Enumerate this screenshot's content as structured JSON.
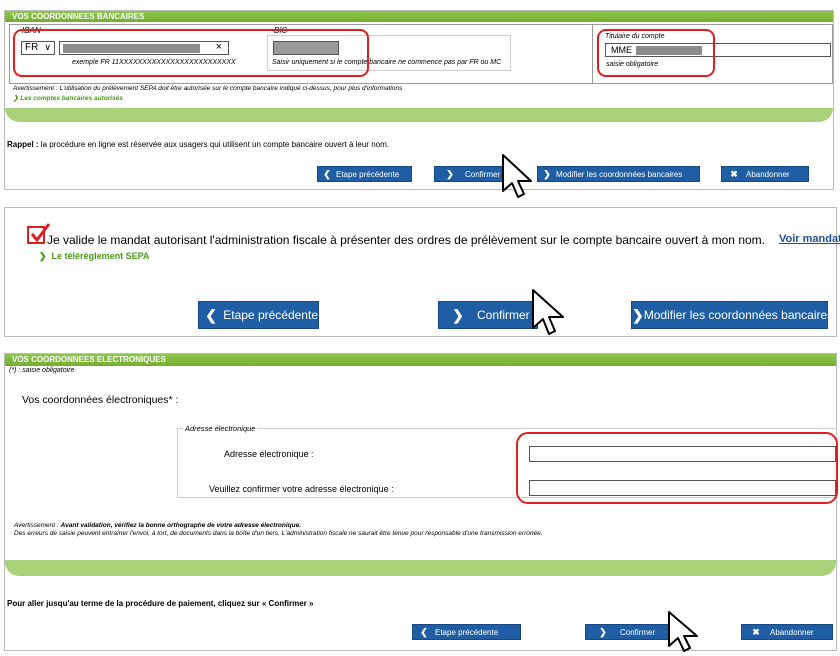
{
  "bank": {
    "header": "VOS COORDONNEES BANCAIRES",
    "iban_label": "IBAN",
    "iban_country": "FR",
    "iban_example": "exemple FR 11XXXXXXXXXXXXXXXXXXXXXXXXX",
    "iban_clear": "×",
    "bic_label": "BIC",
    "bic_hint": "Saisir uniquement si le compte bancaire ne commence pas par FR ou MC",
    "holder_label": "Titulaire du compte",
    "holder_prefix": "MME",
    "required_note": "saisie obligatoire",
    "warning": "Avertissement :   L'utilisation du prélèvement SEPA doit être autorisée sur le compte bancaire indiqué ci-dessus, pour plus d'informations",
    "warning_link": "Les comptes bancaires autorisés",
    "rappel_bold": "Rappel :",
    "rappel_text": " la procédure en ligne est réservée aux usagers qui utilisent un compte bancaire ouvert à leur nom.",
    "btn_prev": "Etape précédente",
    "btn_confirm": "Confirmer",
    "btn_modify": "Modifier les coordonnées bancaires",
    "btn_abandon": "Abandonner"
  },
  "mandate": {
    "checkbox_label": "Je valide le mandat autorisant l'administration fiscale à présenter des ordres de prélèvement sur le compte bancaire ouvert à mon nom.",
    "link_voir": "Voir mandat",
    "link_sepa": "Le télérèglement SEPA",
    "btn_prev": "Etape précédente",
    "btn_confirm": "Confirmer",
    "btn_modify": "Modifier les coordonnées bancaires"
  },
  "email": {
    "header": "VOS COORDONNEES ELECTRONIQUES",
    "required_note": "(*) : saisie obligatoire",
    "section_title": "Vos coordonnées électroniques* :",
    "fieldset_legend": "Adresse électronique",
    "label_email": "Adresse électronique :",
    "label_confirm": "Veuillez confirmer votre adresse électronique :",
    "warning_prefix": "Avertissement : ",
    "warning_bold": "Avant validation, vérifiez la bonne orthographe de votre adresse électronique.",
    "warning_line2": "Des erreurs de saisie peuvent entraîner l'envoi, à tort, de documents dans la boîte d'un tiers. L'administration fiscale ne saurait être tenue pour responsable d'une transmission erronée.",
    "final_note": "Pour aller jusqu'au terme de la procédure de paiement, cliquez sur « Confirmer »",
    "btn_prev": "Etape précédente",
    "btn_confirm": "Confirmer",
    "btn_abandon": "Abandonner"
  },
  "colors": {
    "green": "#8fc64d",
    "button": "#1f5ea5",
    "highlight": "#e02020",
    "link_green": "#4a9a1a",
    "link_blue": "#1f4fa0"
  },
  "icons": {
    "prev": "chevron-left-icon",
    "next": "chevron-right-icon",
    "close": "close-icon",
    "check": "checkmark-icon",
    "cursor": "mouse-pointer-icon"
  }
}
